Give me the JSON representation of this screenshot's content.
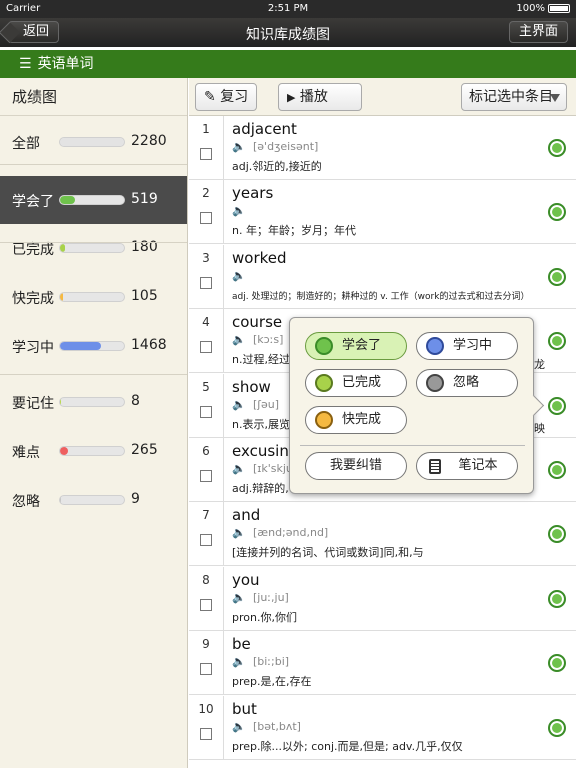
{
  "status": {
    "carrier": "Carrier",
    "time": "2:51 PM",
    "battery": "100%"
  },
  "nav": {
    "back": "返回",
    "title": "知识库成绩图",
    "home": "主界面"
  },
  "sub": {
    "menu_icon": "☰",
    "title": "英语单词"
  },
  "left": {
    "header": "成绩图",
    "rows": [
      {
        "label": "全部",
        "count": "2280",
        "fill": 1.0,
        "color": "#e3e3e3"
      },
      {
        "label": "学会了",
        "count": "519",
        "fill": 0.23,
        "color": "#6fc24c",
        "selected": true
      },
      {
        "label": "已完成",
        "count": "180",
        "fill": 0.08,
        "color": "#a8d24a"
      },
      {
        "label": "快完成",
        "count": "105",
        "fill": 0.05,
        "color": "#f5b942"
      },
      {
        "label": "学习中",
        "count": "1468",
        "fill": 0.64,
        "color": "#6d8fe8"
      },
      {
        "label": "要记住",
        "count": "8",
        "fill": 0.01,
        "color": "#b8d84a"
      },
      {
        "label": "难点",
        "count": "265",
        "fill": 0.12,
        "color": "#ee5f5f"
      },
      {
        "label": "忽略",
        "count": "9",
        "fill": 0.01,
        "color": "#c5c5c5"
      }
    ]
  },
  "toolbar": {
    "review": "复习",
    "review_icon": "✎",
    "play": "播放",
    "play_icon": "▶",
    "mark": "标记选中条目"
  },
  "words": [
    {
      "n": "1",
      "w": "adjacent",
      "ph": "[ə'dʒeisənt]",
      "d": "adj.邻近的,接近的"
    },
    {
      "n": "2",
      "w": "years",
      "ph": "",
      "d": "n. 年；年龄；岁月；年代"
    },
    {
      "n": "3",
      "w": "worked",
      "ph": "",
      "d": "adj. 处理过的；制造好的；耕种过的 v. 工作（work的过去式和过去分词）"
    },
    {
      "n": "4",
      "w": "course",
      "ph": "[kɔːs]",
      "d": "n.过程,经过,进"
    },
    {
      "n": "5",
      "w": "show",
      "ph": "[ʃəu]",
      "d": "n.表示,展览,"
    },
    {
      "n": "6",
      "w": "excusing",
      "ph": "[ɪk'skju",
      "d": "adj.辩辞的,"
    },
    {
      "n": "7",
      "w": "and",
      "ph": "[ænd;ənd,nd]",
      "d": "[连接并列的名词、代词或数词]同,和,与"
    },
    {
      "n": "8",
      "w": "you",
      "ph": "[juː,ju]",
      "d": "pron.你,你们"
    },
    {
      "n": "9",
      "w": "be",
      "ph": "[biː;bi]",
      "d": "prep.是,在,存在"
    },
    {
      "n": "10",
      "w": "but",
      "ph": "[bət,bʌt]",
      "d": "prep.除...以外; conj.而是,但是; adv.几乎,仅仅"
    }
  ],
  "speaker_icon": "🔈",
  "partial_right": {
    "r4": "龙",
    "r5": "映"
  },
  "popup": {
    "learned": "学会了",
    "learning": "学习中",
    "done": "已完成",
    "ignore": "忽略",
    "almost": "快完成",
    "correct": "我要纠错",
    "notebook": "笔记本"
  }
}
